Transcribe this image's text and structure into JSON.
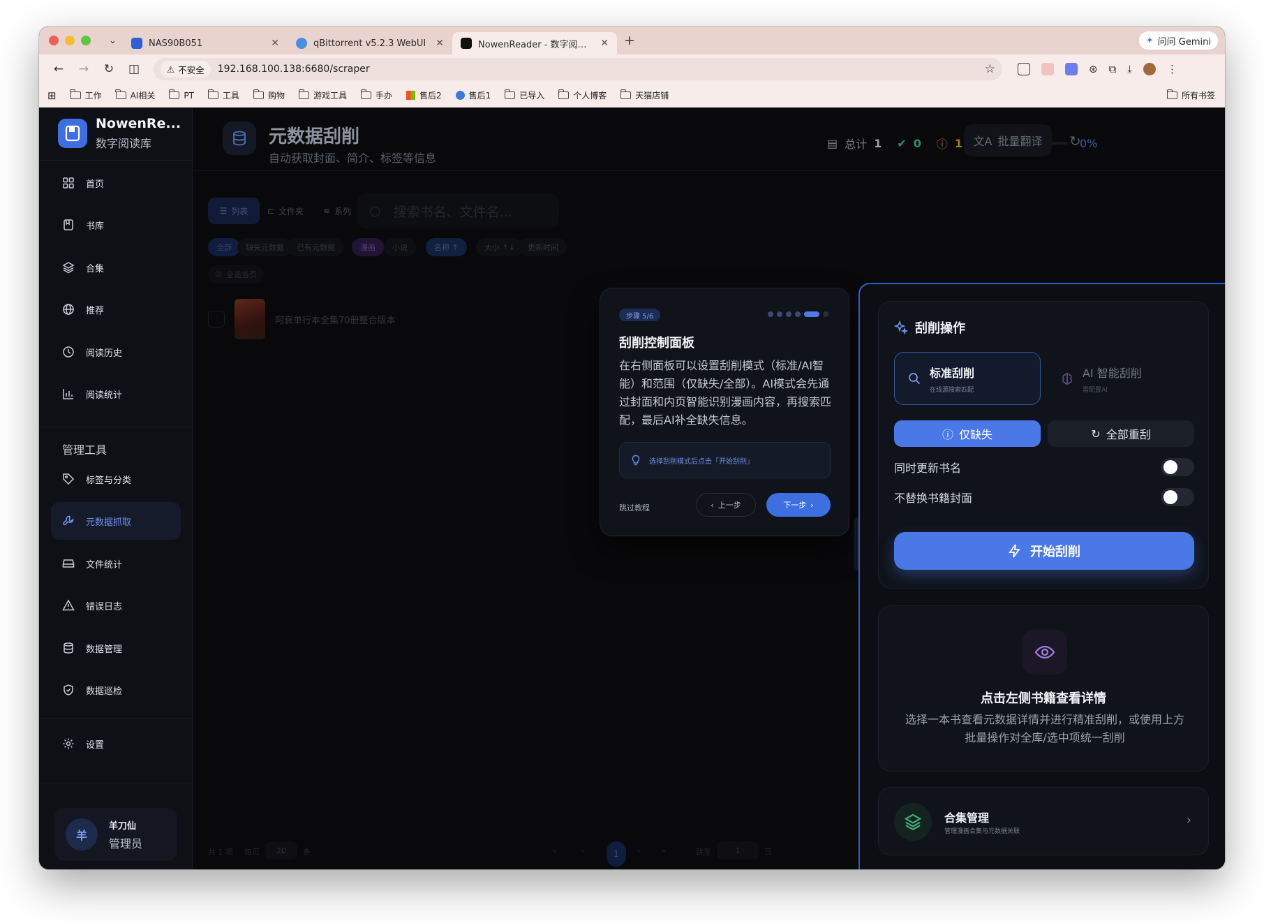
{
  "browser": {
    "tabs": [
      {
        "label": "NAS90B051",
        "active": false
      },
      {
        "label": "qBittorrent v5.2.3 WebUI",
        "active": false
      },
      {
        "label": "NowenReader - 数字阅读库",
        "active": true
      }
    ],
    "gemini_label": "问问 Gemini",
    "insecure_label": "不安全",
    "url": "192.168.100.138:6680/scraper",
    "bookmarks": [
      "工作",
      "AI相关",
      "PT",
      "工具",
      "购物",
      "游戏工具",
      "手办",
      "售后2",
      "售后1",
      "已导入",
      "个人博客",
      "天猫店铺"
    ],
    "all_bookmarks": "所有书签"
  },
  "sidebar": {
    "brand_name": "NowenRe...",
    "brand_sub": "数字阅读库",
    "items": [
      {
        "label": "首页",
        "icon": "grid-icon"
      },
      {
        "label": "书库",
        "icon": "book-icon"
      },
      {
        "label": "合集",
        "icon": "layers-icon"
      },
      {
        "label": "推荐",
        "icon": "globe-icon"
      },
      {
        "label": "阅读历史",
        "icon": "clock-icon"
      },
      {
        "label": "阅读统计",
        "icon": "bar-chart-icon"
      }
    ],
    "section_title": "管理工具",
    "tools": [
      {
        "label": "标签与分类",
        "icon": "tag-icon"
      },
      {
        "label": "元数据抓取",
        "icon": "wrench-icon",
        "active": true
      },
      {
        "label": "文件统计",
        "icon": "drive-icon"
      },
      {
        "label": "错误日志",
        "icon": "warning-icon"
      },
      {
        "label": "数据管理",
        "icon": "database-icon"
      },
      {
        "label": "数据巡检",
        "icon": "shield-icon"
      }
    ],
    "settings_label": "设置",
    "user": {
      "avatar": "羊",
      "name": "羊刀仙",
      "role": "管理员"
    }
  },
  "header": {
    "title": "元数据刮削",
    "subtitle": "自动获取封面、简介、标签等信息",
    "total_label": "总计",
    "total": "1",
    "ok_count": "0",
    "warn_count": "1",
    "progress_pct": "0%",
    "progress_value": 0,
    "translate_label": "批量翻译"
  },
  "toolbar": {
    "views": [
      "列表",
      "文件夹",
      "系列"
    ],
    "search_placeholder": "搜索书名、文件名...",
    "filters": [
      "全部",
      "缺失元数据",
      "已有元数据",
      "漫画",
      "小说"
    ],
    "sorts": [
      "名称 ↑",
      "大小 ↑↓",
      "更新时间"
    ],
    "select_all": "全选当页"
  },
  "books": [
    {
      "title": "阿衰单行本全集70册整合版本"
    }
  ],
  "pager": {
    "total": "共 1 项",
    "per_page_label": "每页",
    "per_page": "20",
    "unit": "条",
    "current": "1",
    "jump_label": "跳至",
    "jump_value": "1",
    "page_unit": "页"
  },
  "tour": {
    "step": "步骤 5/6",
    "title": "刮削控制面板",
    "body": "在右侧面板可以设置刮削模式（标准/AI智能）和范围（仅缺失/全部）。AI模式会先通过封面和内页智能识别漫画内容，再搜索匹配，最后AI补全缺失信息。",
    "tip": "选择刮削模式后点击「开始刮削」",
    "skip": "跳过教程",
    "prev": "上一步",
    "next": "下一步"
  },
  "panel": {
    "title": "刮削操作",
    "modes": [
      {
        "name": "标准刮削",
        "desc": "在线源搜索匹配",
        "selected": true
      },
      {
        "name": "AI 智能刮削",
        "desc": "需配置AI",
        "selected": false
      }
    ],
    "scope": [
      {
        "label": "仅缺失",
        "selected": true
      },
      {
        "label": "全部重刮",
        "selected": false
      }
    ],
    "toggles": [
      {
        "label": "同时更新书名",
        "on": false
      },
      {
        "label": "不替换书籍封面",
        "on": false
      }
    ],
    "start_label": "开始刮削",
    "detail_title": "点击左侧书籍查看详情",
    "detail_desc": "选择一本书查看元数据详情并进行精准刮削，或使用上方批量操作对全库/选中项统一刮削",
    "collection_title": "合集管理",
    "collection_sub": "管理漫画合集与元数据关联"
  },
  "colors": {
    "accent": "#4a78e6",
    "background": "#09090b",
    "sidebar": "#0e1016",
    "success": "#2f8f63",
    "warning": "#a8771f"
  }
}
